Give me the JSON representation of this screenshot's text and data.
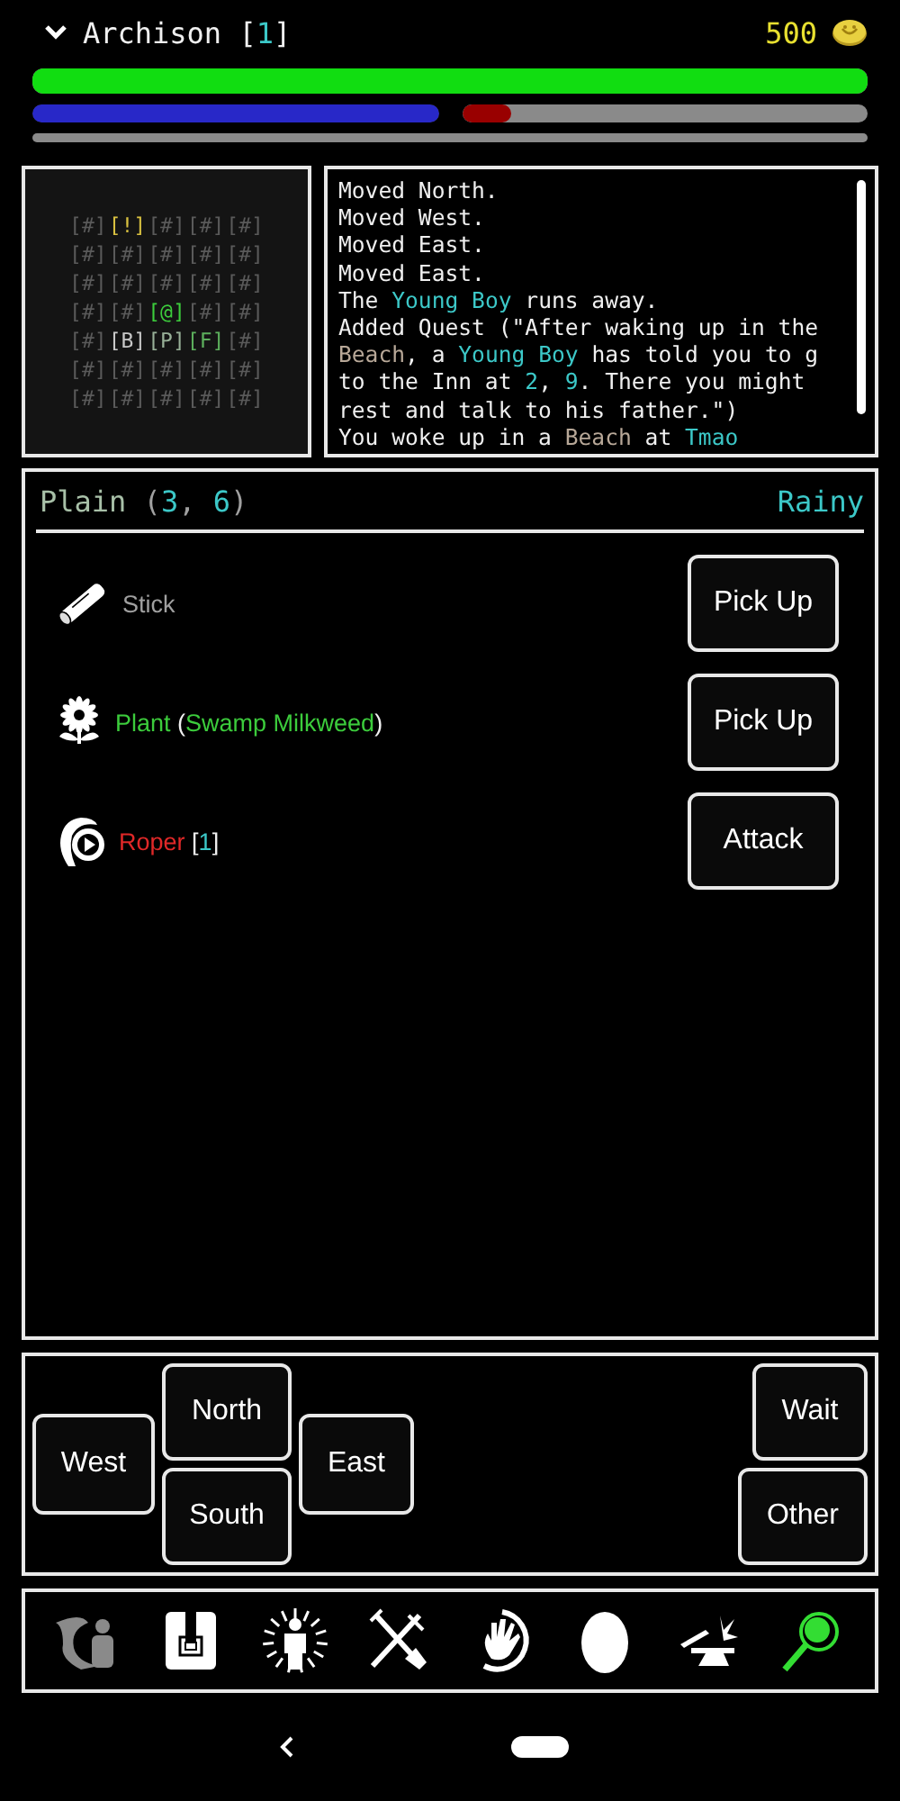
{
  "header": {
    "name": [
      {
        "text": "Archison [",
        "kind": "plain"
      },
      {
        "text": "1",
        "kind": "number"
      },
      {
        "text": "]",
        "kind": "plain"
      }
    ],
    "gold": "500"
  },
  "bars": [
    {
      "kind": "health",
      "level": 1
    },
    {
      "kind": "mana",
      "level": 1
    },
    {
      "kind": "stamina",
      "level": 0.12
    },
    {
      "kind": "experience"
    }
  ],
  "map": [
    [
      {
        "text": "[#]",
        "color": "#5a5a5a"
      },
      {
        "text": "[!]",
        "color": "#d8c040"
      },
      {
        "text": "[#]",
        "color": "#5a5a5a"
      },
      {
        "text": "[#]",
        "color": "#5a5a5a"
      },
      {
        "text": "[#]",
        "color": "#5a5a5a"
      }
    ],
    [
      {
        "text": "[#]",
        "color": "#5a5a5a"
      },
      {
        "text": "[#]",
        "color": "#5a5a5a"
      },
      {
        "text": "[#]",
        "color": "#5a5a5a"
      },
      {
        "text": "[#]",
        "color": "#5a5a5a"
      },
      {
        "text": "[#]",
        "color": "#5a5a5a"
      }
    ],
    [
      {
        "text": "[#]",
        "color": "#5a5a5a"
      },
      {
        "text": "[#]",
        "color": "#5a5a5a"
      },
      {
        "text": "[#]",
        "color": "#5a5a5a"
      },
      {
        "text": "[#]",
        "color": "#5a5a5a"
      },
      {
        "text": "[#]",
        "color": "#5a5a5a"
      }
    ],
    [
      {
        "text": "[#]",
        "color": "#5a5a5a"
      },
      {
        "text": "[#]",
        "color": "#5a5a5a"
      },
      {
        "text": "[@]",
        "color": "#3ccc3c"
      },
      {
        "text": "[#]",
        "color": "#5a5a5a"
      },
      {
        "text": "[#]",
        "color": "#5a5a5a"
      }
    ],
    [
      {
        "text": "[#]",
        "color": "#5a5a5a"
      },
      {
        "text": "[B]",
        "color": "#c8c8c8"
      },
      {
        "text": "[P]",
        "color": "#98b098"
      },
      {
        "text": "[F]",
        "color": "#5cae5c"
      },
      {
        "text": "[#]",
        "color": "#5a5a5a"
      }
    ],
    [
      {
        "text": "[#]",
        "color": "#5a5a5a"
      },
      {
        "text": "[#]",
        "color": "#5a5a5a"
      },
      {
        "text": "[#]",
        "color": "#5a5a5a"
      },
      {
        "text": "[#]",
        "color": "#5a5a5a"
      },
      {
        "text": "[#]",
        "color": "#5a5a5a"
      }
    ],
    [
      {
        "text": "[#]",
        "color": "#5a5a5a"
      },
      {
        "text": "[#]",
        "color": "#5a5a5a"
      },
      {
        "text": "[#]",
        "color": "#5a5a5a"
      },
      {
        "text": "[#]",
        "color": "#5a5a5a"
      },
      {
        "text": "[#]",
        "color": "#5a5a5a"
      }
    ]
  ],
  "log": [
    [
      {
        "text": "Moved North.",
        "kind": "plain"
      }
    ],
    [
      {
        "text": "Moved West.",
        "kind": "plain"
      }
    ],
    [
      {
        "text": "Moved East.",
        "kind": "plain"
      }
    ],
    [
      {
        "text": "Moved East.",
        "kind": "plain"
      }
    ],
    [
      {
        "text": "The ",
        "kind": "plain"
      },
      {
        "text": "Young Boy",
        "kind": "name"
      },
      {
        "text": " runs away.",
        "kind": "plain"
      }
    ],
    [
      {
        "text": "Added Quest (\"After waking up in the",
        "kind": "plain"
      }
    ],
    [
      {
        "text": "Beach",
        "kind": "place"
      },
      {
        "text": ", a ",
        "kind": "plain"
      },
      {
        "text": "Young Boy",
        "kind": "name"
      },
      {
        "text": " has told you to g",
        "kind": "plain"
      }
    ],
    [
      {
        "text": "to the Inn at ",
        "kind": "plain"
      },
      {
        "text": "2",
        "kind": "number"
      },
      {
        "text": ", ",
        "kind": "plain"
      },
      {
        "text": "9",
        "kind": "number"
      },
      {
        "text": ". There you might",
        "kind": "plain"
      }
    ],
    [
      {
        "text": "rest and talk to his father.\")",
        "kind": "plain"
      }
    ],
    [
      {
        "text": "You woke up in a ",
        "kind": "plain"
      },
      {
        "text": "Beach",
        "kind": "place"
      },
      {
        "text": " at ",
        "kind": "plain"
      },
      {
        "text": "Tmao",
        "kind": "name"
      }
    ]
  ],
  "location": {
    "title": [
      {
        "text": "Plain",
        "kind": "terrain"
      },
      {
        "text": " (",
        "kind": "dim"
      },
      {
        "text": "3",
        "kind": "number"
      },
      {
        "text": ", ",
        "kind": "dim"
      },
      {
        "text": "6",
        "kind": "number"
      },
      {
        "text": ")",
        "kind": "dim"
      }
    ],
    "weather": "Rainy"
  },
  "entities": [
    {
      "kind": "stick",
      "name": [
        {
          "text": "Stick",
          "kind": "dim"
        }
      ],
      "action": "Pick Up"
    },
    {
      "kind": "plant",
      "name": [
        {
          "text": "Plant",
          "kind": "item"
        },
        {
          "text": " (",
          "kind": "plain"
        },
        {
          "text": "Swamp Milkweed",
          "kind": "item"
        },
        {
          "text": ")",
          "kind": "plain"
        }
      ],
      "action": "Pick Up"
    },
    {
      "kind": "creature",
      "name": [
        {
          "text": "Roper",
          "kind": "hostile"
        },
        {
          "text": " [",
          "kind": "plain"
        },
        {
          "text": "1",
          "kind": "number"
        },
        {
          "text": "]",
          "kind": "plain"
        }
      ],
      "action": "Attack"
    }
  ],
  "movement": {
    "west": "West",
    "north": "North",
    "south": "South",
    "east": "East",
    "wait": "Wait",
    "other": "Other"
  },
  "toolbar": [
    {
      "kind": "road",
      "selected": false,
      "disabled": true
    },
    {
      "kind": "backpack",
      "selected": false,
      "disabled": false
    },
    {
      "kind": "aura",
      "selected": false,
      "disabled": false
    },
    {
      "kind": "tools",
      "selected": false,
      "disabled": false
    },
    {
      "kind": "hand",
      "selected": false,
      "disabled": false
    },
    {
      "kind": "egg",
      "selected": false,
      "disabled": false
    },
    {
      "kind": "anvil",
      "selected": false,
      "disabled": false
    },
    {
      "kind": "search",
      "selected": true,
      "disabled": false
    }
  ]
}
